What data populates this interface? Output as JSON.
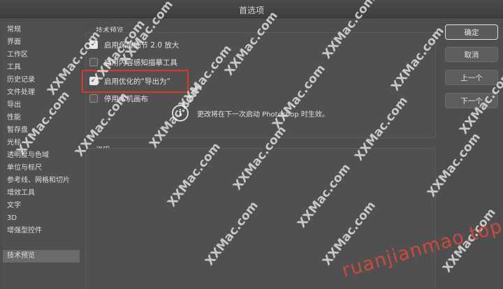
{
  "window": {
    "title": "首选项"
  },
  "sidebar": {
    "items": [
      {
        "label": "常规"
      },
      {
        "label": "界面"
      },
      {
        "label": "工作区"
      },
      {
        "label": "工具"
      },
      {
        "label": "历史记录"
      },
      {
        "label": "文件处理"
      },
      {
        "label": "导出"
      },
      {
        "label": "性能"
      },
      {
        "label": "暂存盘"
      },
      {
        "label": "光标"
      },
      {
        "label": "透明度与色域"
      },
      {
        "label": "单位与标尺"
      },
      {
        "label": "参考线、网格和切片"
      },
      {
        "label": "增效工具"
      },
      {
        "label": "文字"
      },
      {
        "label": "3D"
      },
      {
        "label": "增强型控件"
      },
      {
        "label": "技术预览",
        "selected": true
      }
    ]
  },
  "tech_preview": {
    "title": "技术预览",
    "options": [
      {
        "label": "启用保留细节 2.0 放大",
        "checked": true
      },
      {
        "label": "启用内容感知描摹工具",
        "checked": false
      },
      {
        "label": "启用优化的“导出为”",
        "checked": true
      },
      {
        "label": "停用本机画布",
        "checked": false
      }
    ],
    "info_icon": "info-circle-icon",
    "info_text": "更改将在下一次启动 Photoshop 时生效。"
  },
  "description": {
    "title": "说明"
  },
  "buttons": {
    "ok": "确定",
    "cancel": "取消",
    "prev": "上一个",
    "next": "下一个"
  },
  "watermark": {
    "text": "XXMac.com",
    "site": "ruanjianmao.top"
  },
  "colors": {
    "highlight": "#d9382d",
    "site_watermark": "#e2483c"
  }
}
